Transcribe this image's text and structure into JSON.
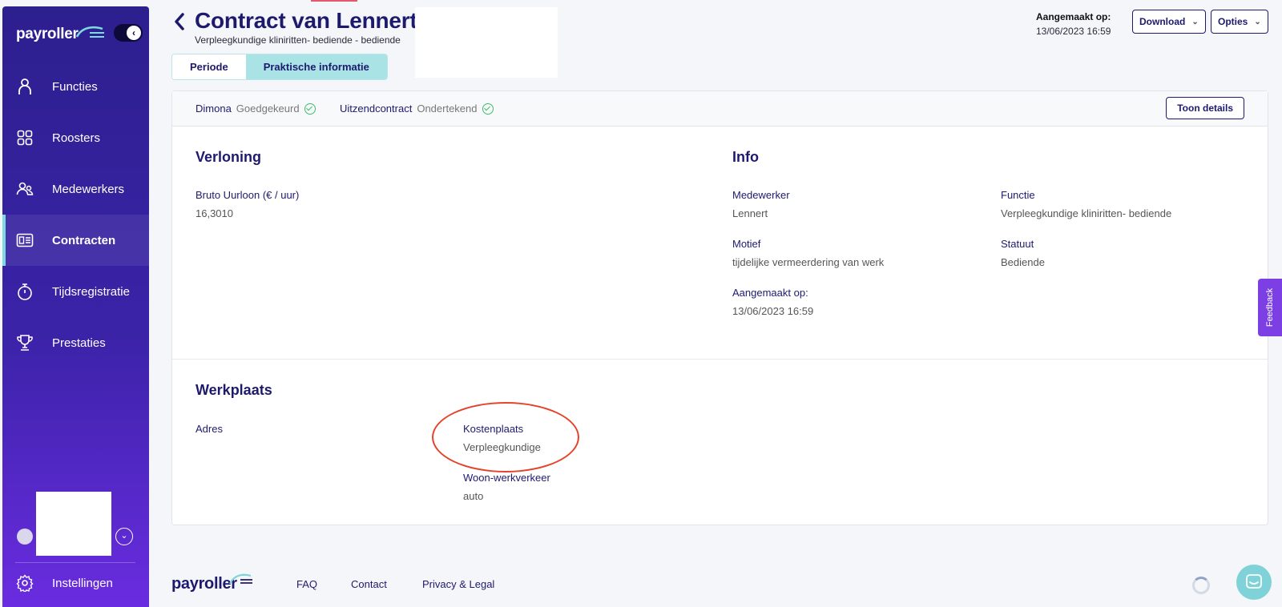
{
  "app": {
    "logo_text": "payroller"
  },
  "sidebar": {
    "items": [
      {
        "label": "Functies",
        "icon": "user-icon"
      },
      {
        "label": "Roosters",
        "icon": "grid-icon"
      },
      {
        "label": "Medewerkers",
        "icon": "users-icon"
      },
      {
        "label": "Contracten",
        "icon": "contract-icon",
        "active": true
      },
      {
        "label": "Tijdsregistratie",
        "icon": "stopwatch-icon"
      },
      {
        "label": "Prestaties",
        "icon": "trophy-icon"
      }
    ],
    "settings_label": "Instellingen"
  },
  "header": {
    "title": "Contract van Lennert",
    "subtitle": "Verpleegkundige kliniritten- bediende - bediende",
    "created_label": "Aangemaakt op:",
    "created_value": "13/06/2023 16:59",
    "download_label": "Download",
    "options_label": "Opties"
  },
  "tabs": [
    {
      "label": "Periode",
      "active": false
    },
    {
      "label": "Praktische informatie",
      "active": true
    }
  ],
  "status": {
    "dimona_label": "Dimona",
    "dimona_value": "Goedgekeurd",
    "uitzend_label": "Uitzendcontract",
    "uitzend_value": "Ondertekend",
    "details_button": "Toon details"
  },
  "verloning": {
    "title": "Verloning",
    "wage_label": "Bruto Uurloon (€ / uur)",
    "wage_value": "16,3010"
  },
  "info": {
    "title": "Info",
    "employee_label": "Medewerker",
    "employee_value": "Lennert",
    "function_label": "Functie",
    "function_value": "Verpleegkundige kliniritten- bediende",
    "motive_label": "Motief",
    "motive_value": "tijdelijke vermeerdering van werk",
    "statute_label": "Statuut",
    "statute_value": "Bediende",
    "created_label": "Aangemaakt op:",
    "created_value": "13/06/2023 16:59"
  },
  "werkplaats": {
    "title": "Werkplaats",
    "address_label": "Adres",
    "cost_label": "Kostenplaats",
    "cost_value": "Verpleegkundige",
    "commute_label": "Woon-werkverkeer",
    "commute_value": "auto"
  },
  "footer": {
    "logo_text": "payroller",
    "links": [
      "FAQ",
      "Contact",
      "Privacy & Legal"
    ]
  },
  "feedback_label": "Feedback",
  "colors": {
    "sidebar_top": "#2c1f8e",
    "sidebar_bottom": "#6a2ce0",
    "accent_teal": "#a9e3e6",
    "navy": "#1d1a6e",
    "success": "#3dbb6c",
    "highlight": "#e4432a",
    "feedback": "#7b3fe4"
  }
}
